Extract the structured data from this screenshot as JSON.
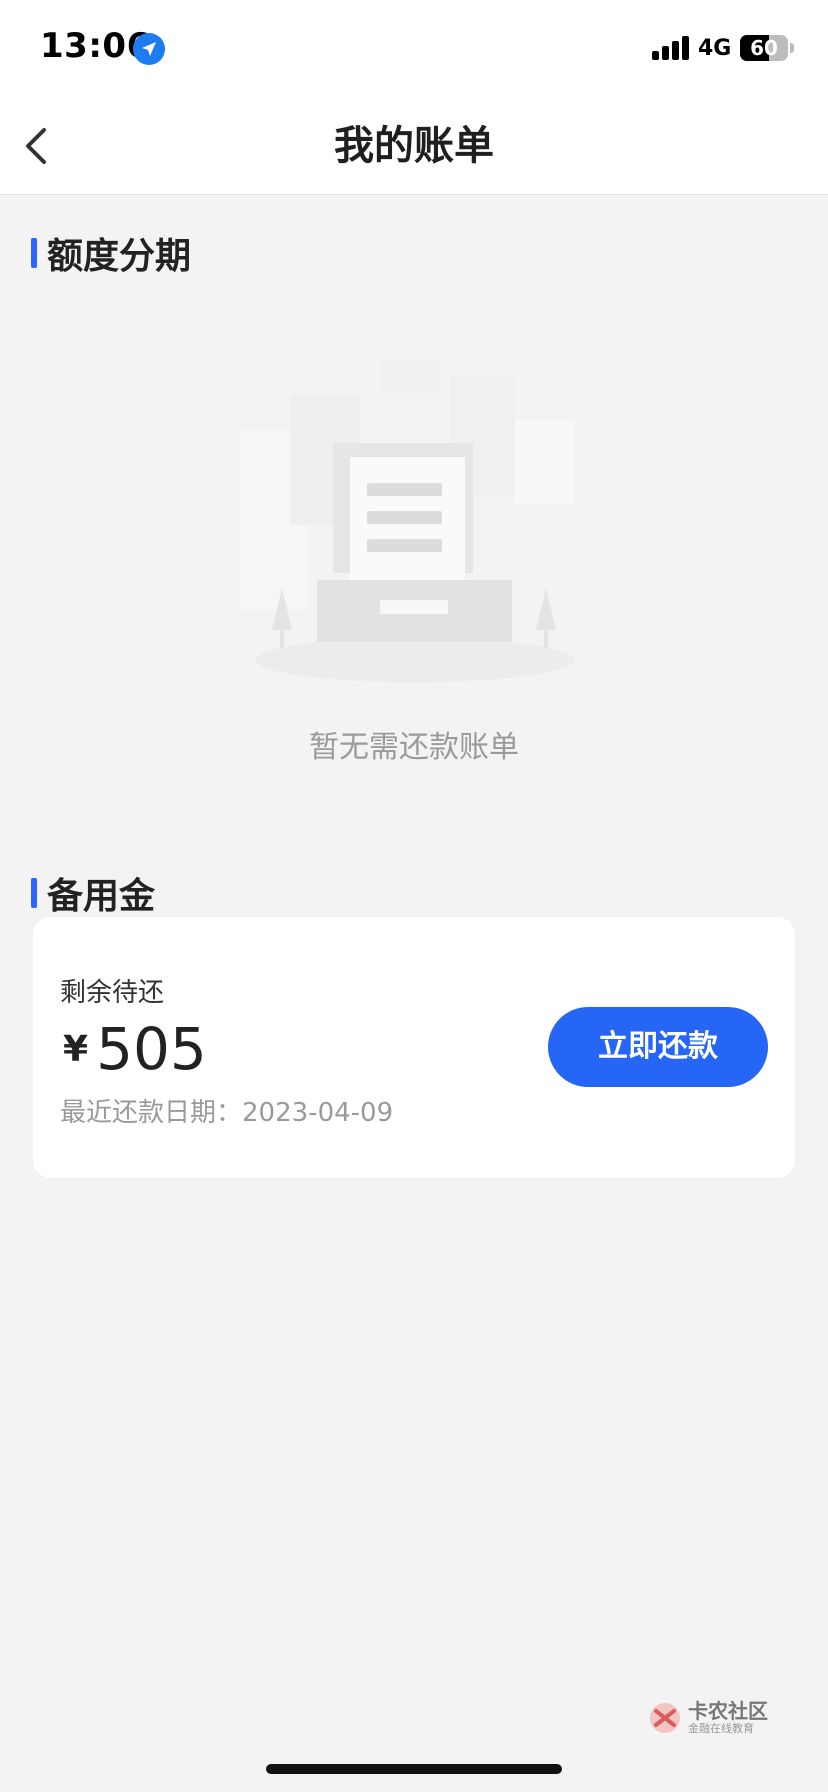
{
  "status_bar": {
    "time": "13:06",
    "network": "4G",
    "battery": "60",
    "battery_level": 0.6,
    "icons": [
      "location-arrow-icon",
      "signal-icon",
      "battery-icon"
    ]
  },
  "nav": {
    "title": "我的账单",
    "back_icon": "chevron-left-icon"
  },
  "section_installment": {
    "title": "额度分期",
    "empty_text": "暂无需还款账单",
    "illustration": "empty-bill-illustration"
  },
  "section_reserve": {
    "title": "备用金",
    "remaining_label": "剩余待还",
    "currency": "¥",
    "amount": "505",
    "due_label": "最近还款日期：",
    "due_date": "2023-04-09",
    "pay_button": "立即还款"
  },
  "watermark": {
    "title": "卡农社区",
    "subtitle": "金融在线教育"
  },
  "colors": {
    "accent": "#2566f6",
    "section_bar": "#2a67ff",
    "background": "#f3f3f3",
    "muted_text": "#9a9a9a"
  }
}
